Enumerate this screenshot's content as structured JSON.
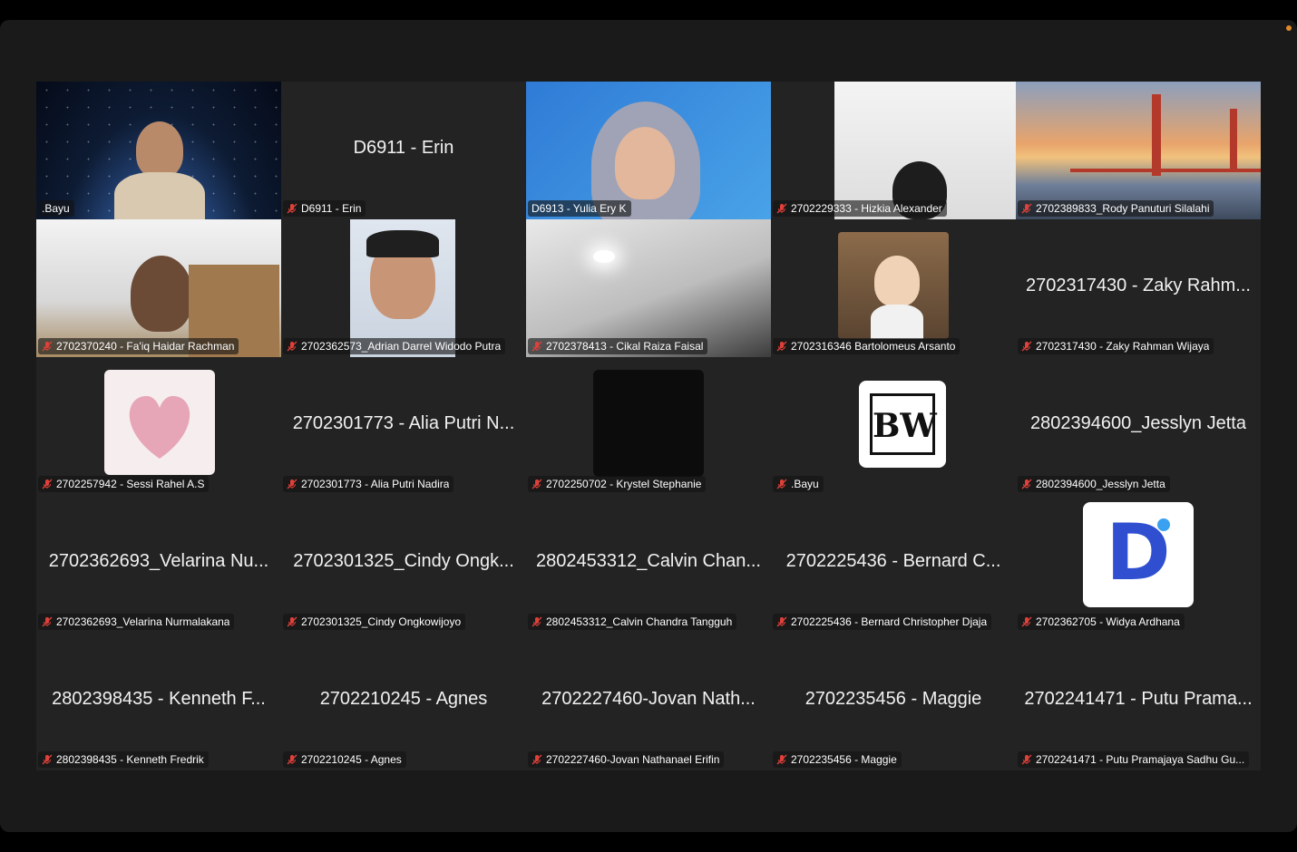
{
  "tiles": [
    {
      "label": ".Bayu",
      "big": "",
      "muted": false
    },
    {
      "label": "D6911 - Erin",
      "big": "D6911 - Erin",
      "muted": true
    },
    {
      "label": "D6913 - Yulia Ery K",
      "big": "",
      "muted": false,
      "active": true
    },
    {
      "label": "2702229333 - Hizkia Alexander",
      "big": "",
      "muted": true
    },
    {
      "label": "2702389833_Rody Panuturi Silalahi",
      "big": "",
      "muted": true
    },
    {
      "label": "2702370240 - Fa'iq Haidar Rachman",
      "big": "",
      "muted": true
    },
    {
      "label": "2702362573_Adrian Darrel Widodo Putra",
      "big": "",
      "muted": true
    },
    {
      "label": "2702378413 - Cikal Raiza Faisal",
      "big": "",
      "muted": true
    },
    {
      "label": "2702316346 Bartolomeus Arsanto",
      "big": "",
      "muted": true
    },
    {
      "label": "2702317430 - Zaky Rahman Wijaya",
      "big": "2702317430 - Zaky Rahm...",
      "muted": true
    },
    {
      "label": "2702257942 - Sessi Rahel A.S",
      "big": "",
      "muted": true
    },
    {
      "label": "2702301773 - Alia Putri Nadira",
      "big": "2702301773 - Alia Putri N...",
      "muted": true
    },
    {
      "label": "2702250702  - Krystel Stephanie",
      "big": "",
      "muted": true
    },
    {
      "label": ".Bayu",
      "big": "",
      "muted": true
    },
    {
      "label": "2802394600_Jesslyn Jetta",
      "big": "2802394600_Jesslyn Jetta",
      "muted": true
    },
    {
      "label": "2702362693_Velarina Nurmalakana",
      "big": "2702362693_Velarina Nu...",
      "muted": true
    },
    {
      "label": "2702301325_Cindy Ongkowijoyo",
      "big": "2702301325_Cindy Ongk...",
      "muted": true
    },
    {
      "label": "2802453312_Calvin Chandra Tangguh",
      "big": "2802453312_Calvin Chan...",
      "muted": true
    },
    {
      "label": "2702225436 - Bernard Christopher Djaja",
      "big": "2702225436 - Bernard C...",
      "muted": true
    },
    {
      "label": "2702362705 - Widya Ardhana",
      "big": "",
      "muted": true
    },
    {
      "label": "2802398435 - Kenneth Fredrik",
      "big": "2802398435 - Kenneth F...",
      "muted": true
    },
    {
      "label": "2702210245 - Agnes",
      "big": "2702210245 - Agnes",
      "muted": true
    },
    {
      "label": "2702227460-Jovan Nathanael Erifin",
      "big": "2702227460-Jovan Nath...",
      "muted": true
    },
    {
      "label": "2702235456 - Maggie",
      "big": "2702235456 - Maggie",
      "muted": true
    },
    {
      "label": "2702241471 - Putu Pramajaya Sadhu Gu...",
      "big": "2702241471 - Putu Prama...",
      "muted": true
    }
  ],
  "avatar_text": {
    "bw": "BW",
    "d": "D"
  },
  "colors": {
    "active_speaker": "#2ec440",
    "muted_icon": "#e0403a",
    "recording_dot": "#e08a2a"
  }
}
